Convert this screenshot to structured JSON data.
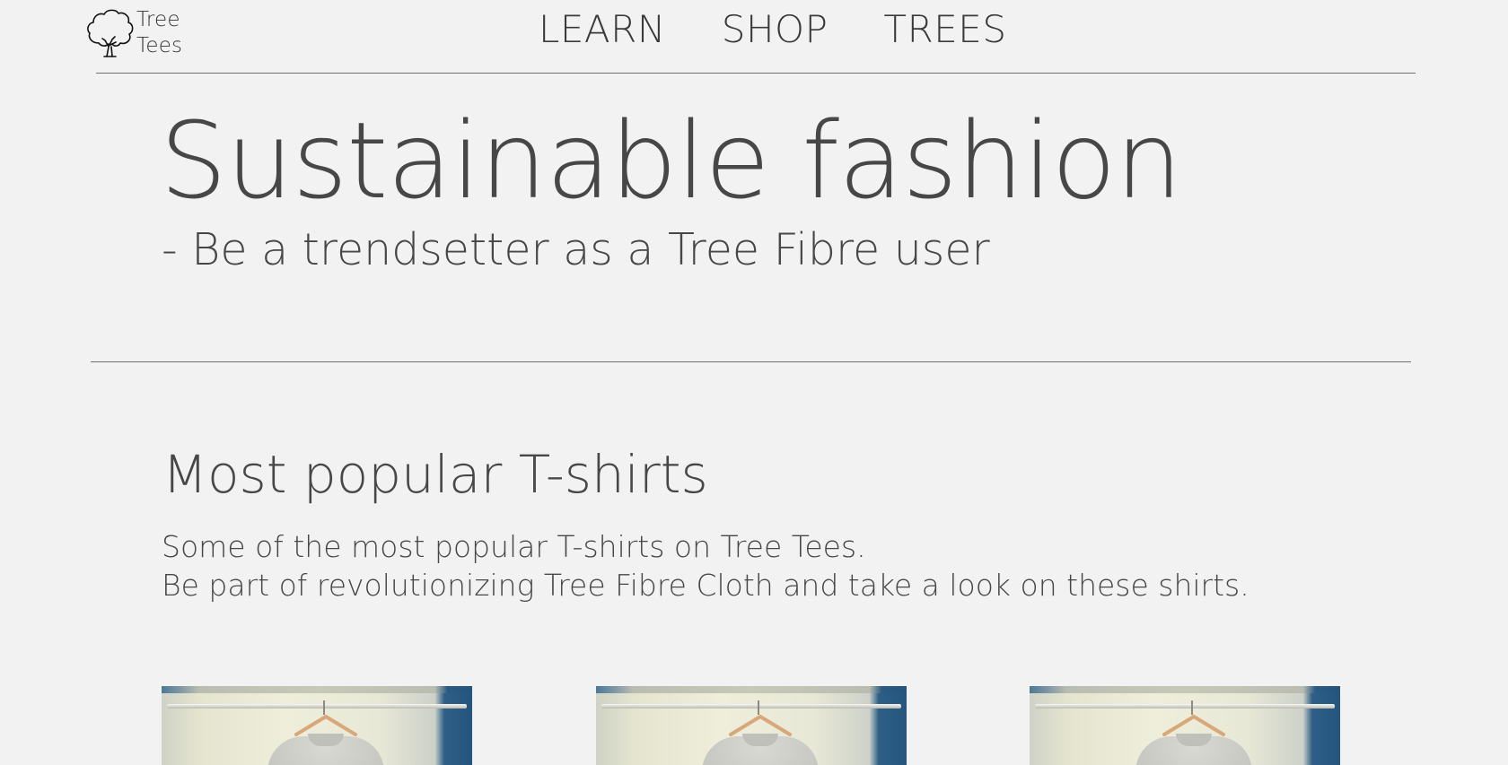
{
  "header": {
    "logo": {
      "icon": "tree-icon",
      "line1": "Tree",
      "line2": "Tees"
    },
    "nav": [
      {
        "label": "LEARN"
      },
      {
        "label": "SHOP"
      },
      {
        "label": "TREES"
      }
    ]
  },
  "hero": {
    "title": "Sustainable fashion",
    "subtitle": "- Be a trendsetter as a Tree Fibre user"
  },
  "popular": {
    "title": "Most popular T-shirts",
    "description_line1": "Some of the most popular T-shirts on Tree Tees.",
    "description_line2": "Be part of revolutionizing Tree Fibre Cloth and take a look on these shirts.",
    "products": [
      {
        "image": "t-shirt-on-hanger-photo"
      },
      {
        "image": "t-shirt-on-hanger-photo"
      },
      {
        "image": "t-shirt-on-hanger-photo"
      }
    ]
  },
  "colors": {
    "background": "#f2f2f2",
    "text": "#474747",
    "rule": "#6f6f6f"
  }
}
